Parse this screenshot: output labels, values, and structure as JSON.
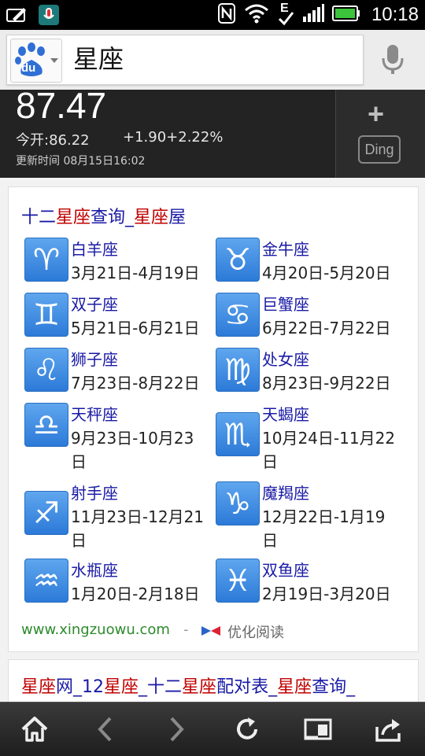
{
  "status_bar": {
    "time": "10:18",
    "signal_letter": "E"
  },
  "search": {
    "query": "星座",
    "logo_text": "du"
  },
  "stock": {
    "price": "87.47",
    "open": "今开:86.22",
    "change": "+1.90+2.22%",
    "updated": "更新时间 08月15日16:02",
    "plus_label": "+",
    "ding_label": "Ding"
  },
  "result1": {
    "title_parts": [
      "十二",
      "星座",
      "查询_",
      "星座",
      "屋"
    ],
    "zodiacs": [
      {
        "name": "白羊座",
        "date": "3月21日-4月19日",
        "icon": "aries-icon",
        "glyph": "♈"
      },
      {
        "name": "金牛座",
        "date": "4月20日-5月20日",
        "icon": "taurus-icon",
        "glyph": "♉"
      },
      {
        "name": "双子座",
        "date": "5月21日-6月21日",
        "icon": "gemini-icon",
        "glyph": "♊"
      },
      {
        "name": "巨蟹座",
        "date": "6月22日-7月22日",
        "icon": "cancer-icon",
        "glyph": "♋"
      },
      {
        "name": "狮子座",
        "date": "7月23日-8月22日",
        "icon": "leo-icon",
        "glyph": "♌"
      },
      {
        "name": "处女座",
        "date": "8月23日-9月22日",
        "icon": "virgo-icon",
        "glyph": "♍"
      },
      {
        "name": "天秤座",
        "date": "9月23日-10月23日",
        "icon": "libra-icon",
        "glyph": "♎"
      },
      {
        "name": "天蝎座",
        "date": "10月24日-11月22日",
        "icon": "scorpio-icon",
        "glyph": "♏"
      },
      {
        "name": "射手座",
        "date": "11月23日-12月21日",
        "icon": "sagittarius-icon",
        "glyph": "♐"
      },
      {
        "name": "魔羯座",
        "date": "12月22日-1月19日",
        "icon": "capricorn-icon",
        "glyph": "♑"
      },
      {
        "name": "水瓶座",
        "date": "1月20日-2月18日",
        "icon": "aquarius-icon",
        "glyph": "♒"
      },
      {
        "name": "双鱼座",
        "date": "2月19日-3月20日",
        "icon": "pisces-icon",
        "glyph": "♓"
      }
    ],
    "site": "www.xingzuowu.com",
    "separator": "-",
    "read_label": "优化阅读"
  },
  "result2": {
    "title_parts": [
      "星座",
      "网_12",
      "星座",
      "_十二",
      "星座",
      "配对表_",
      "星座",
      "查询_"
    ]
  },
  "colors": {
    "link": "#1a1aa6",
    "highlight": "#c00000",
    "site": "#2d8a2d"
  }
}
